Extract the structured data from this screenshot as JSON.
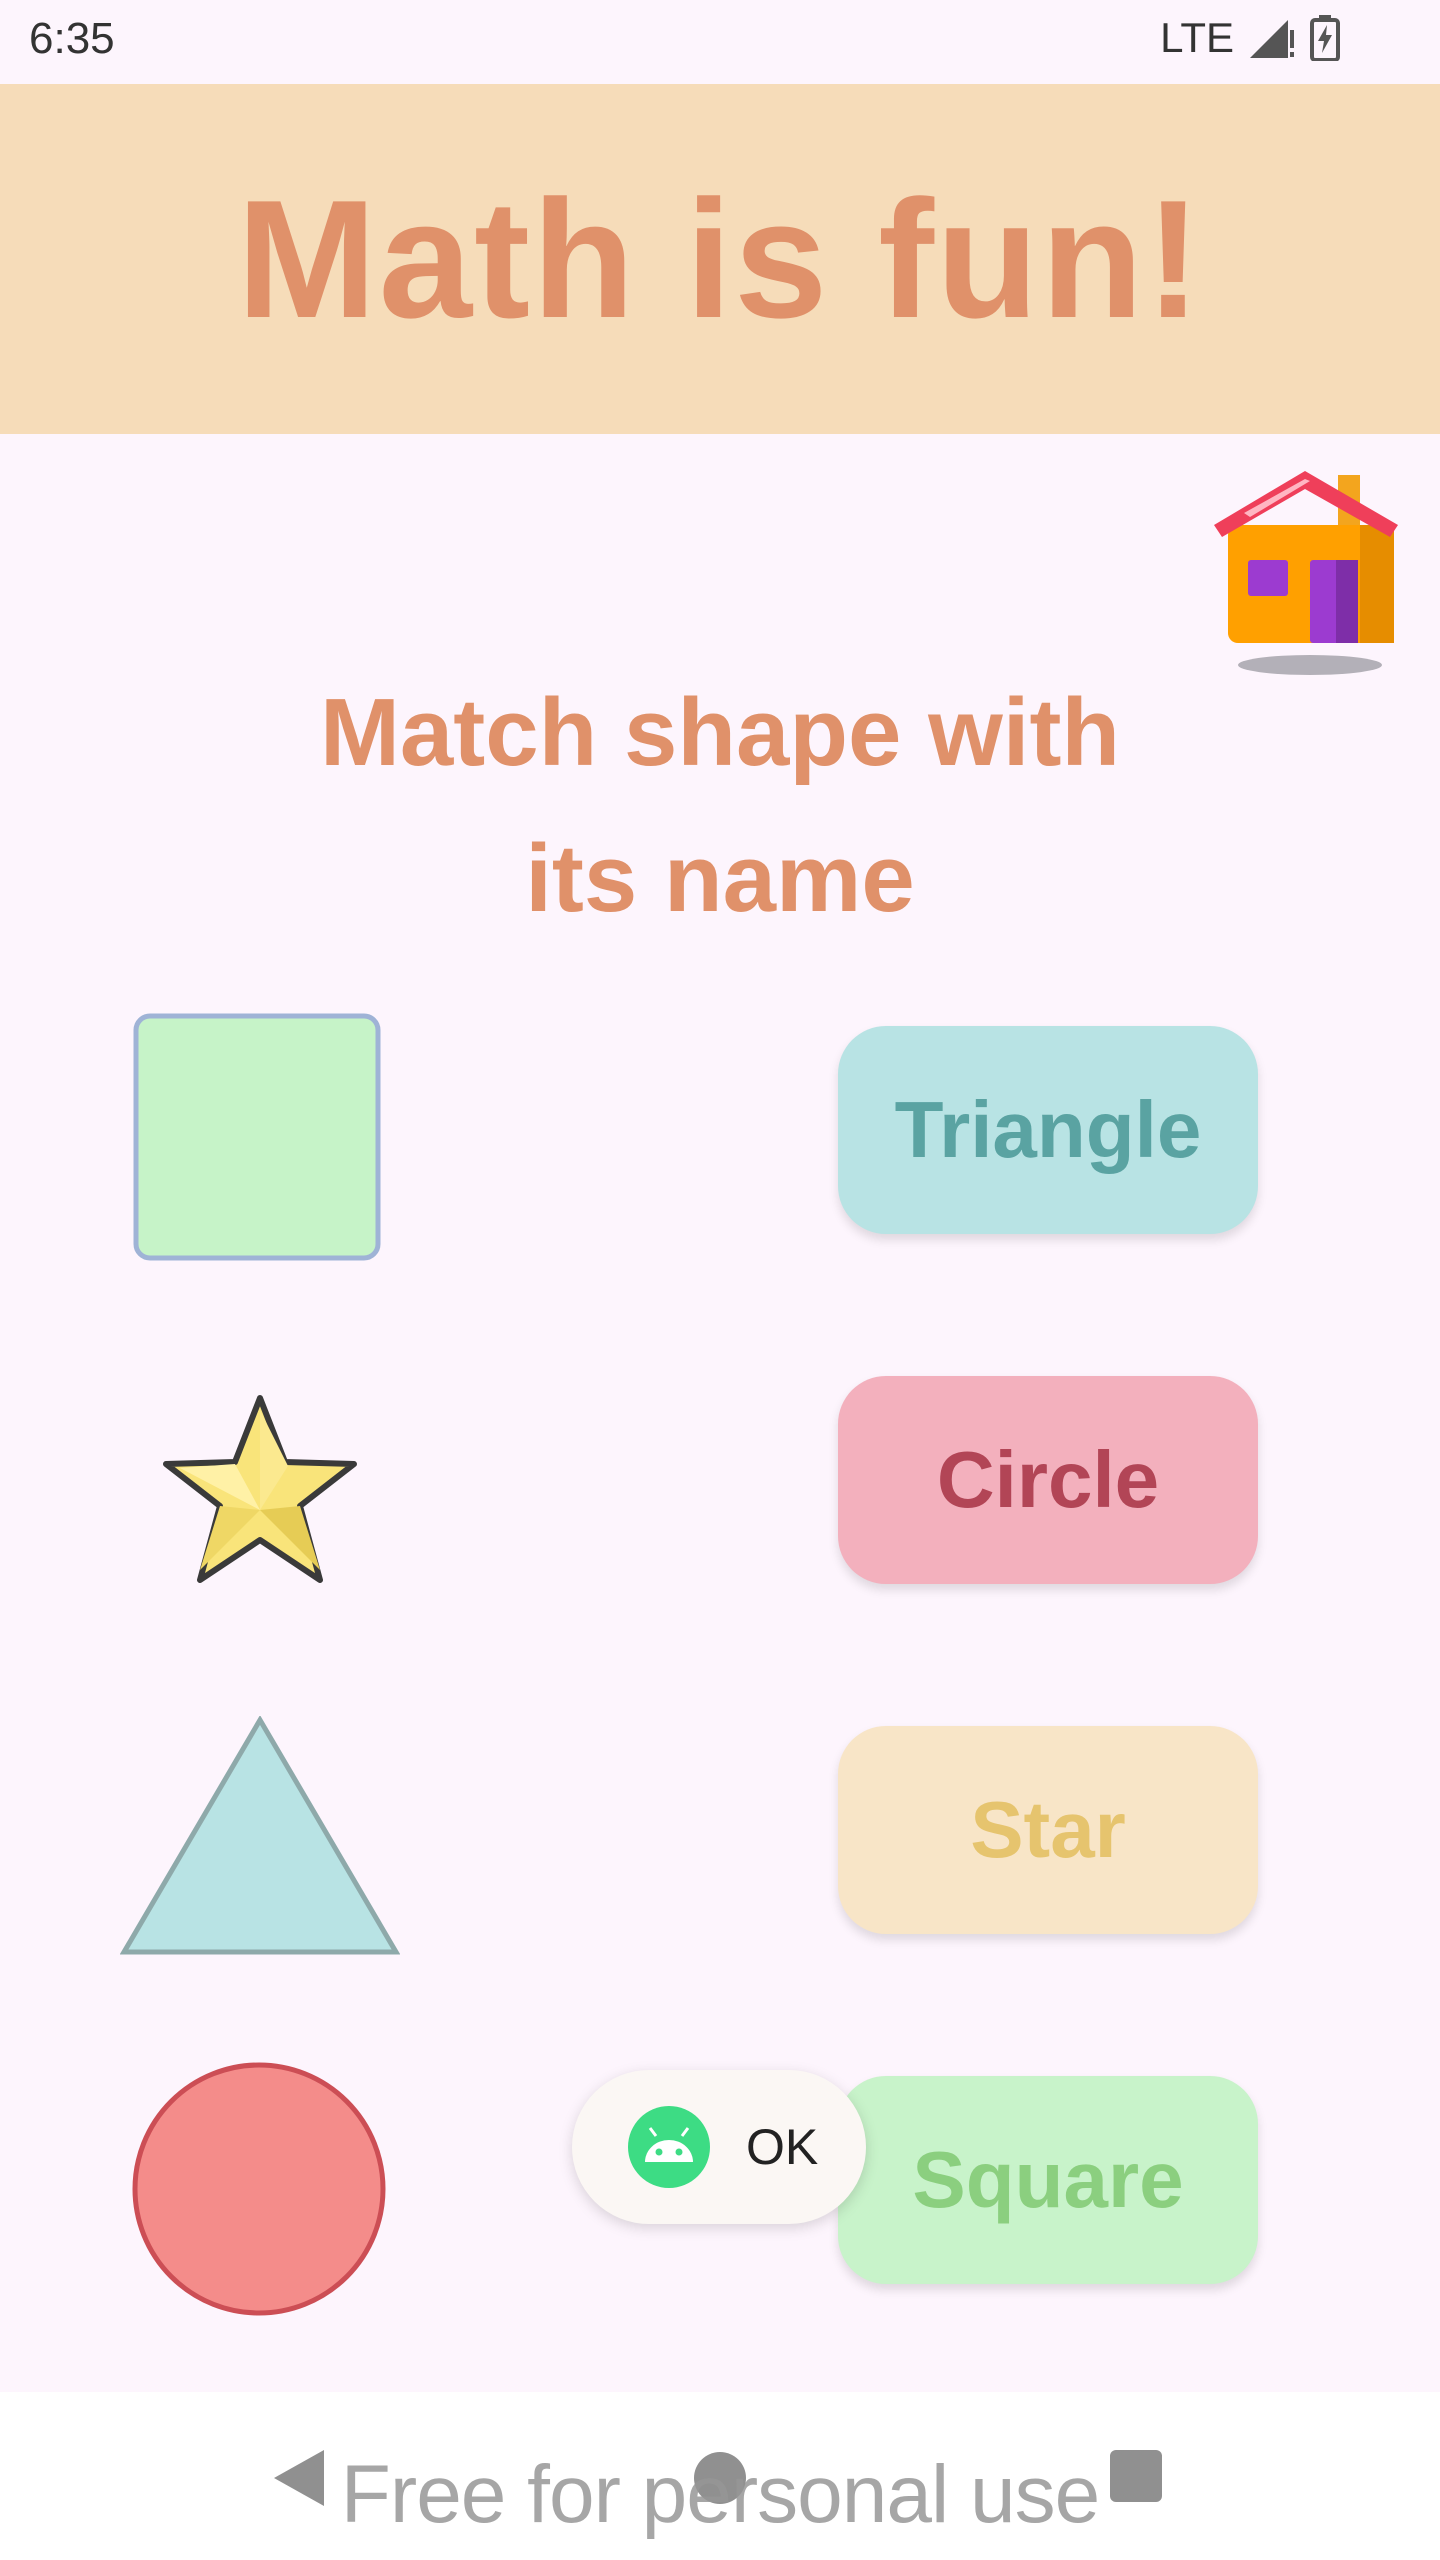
{
  "status_bar": {
    "time": "6:35",
    "network": "LTE",
    "signal_icon": "signal-icon",
    "battery_icon": "battery-charging-icon"
  },
  "header": {
    "title": "Math is fun!",
    "background": "#f6dcb9",
    "title_color": "#e0916a"
  },
  "home_button": {
    "icon": "house-icon"
  },
  "instruction": {
    "line1": "Match shape with",
    "line2": "its name"
  },
  "shapes": [
    {
      "name": "square",
      "icon": "square-shape",
      "color": "#c6f3c8"
    },
    {
      "name": "star",
      "icon": "star-shape",
      "color": "#f9e47a"
    },
    {
      "name": "triangle",
      "icon": "triangle-shape",
      "color": "#b8e3e4"
    },
    {
      "name": "circle",
      "icon": "circle-shape",
      "color": "#f48c8a"
    }
  ],
  "name_buttons": [
    {
      "label": "Triangle",
      "background": "#b8e3e4",
      "color": "#5aa3a2"
    },
    {
      "label": "Circle",
      "background": "#f3b0bd",
      "color": "#b24556"
    },
    {
      "label": "Star",
      "background": "#f8e5c7",
      "color": "#e6c46e"
    },
    {
      "label": "Square",
      "background": "#c8f3ca",
      "color": "#8bcf7f"
    }
  ],
  "toast": {
    "text": "OK",
    "icon": "android-icon"
  },
  "nav_bar": {
    "back_icon": "back-triangle-icon",
    "home_icon": "home-circle-icon",
    "recents_icon": "recents-square-icon"
  },
  "watermark": "Free for personal use"
}
